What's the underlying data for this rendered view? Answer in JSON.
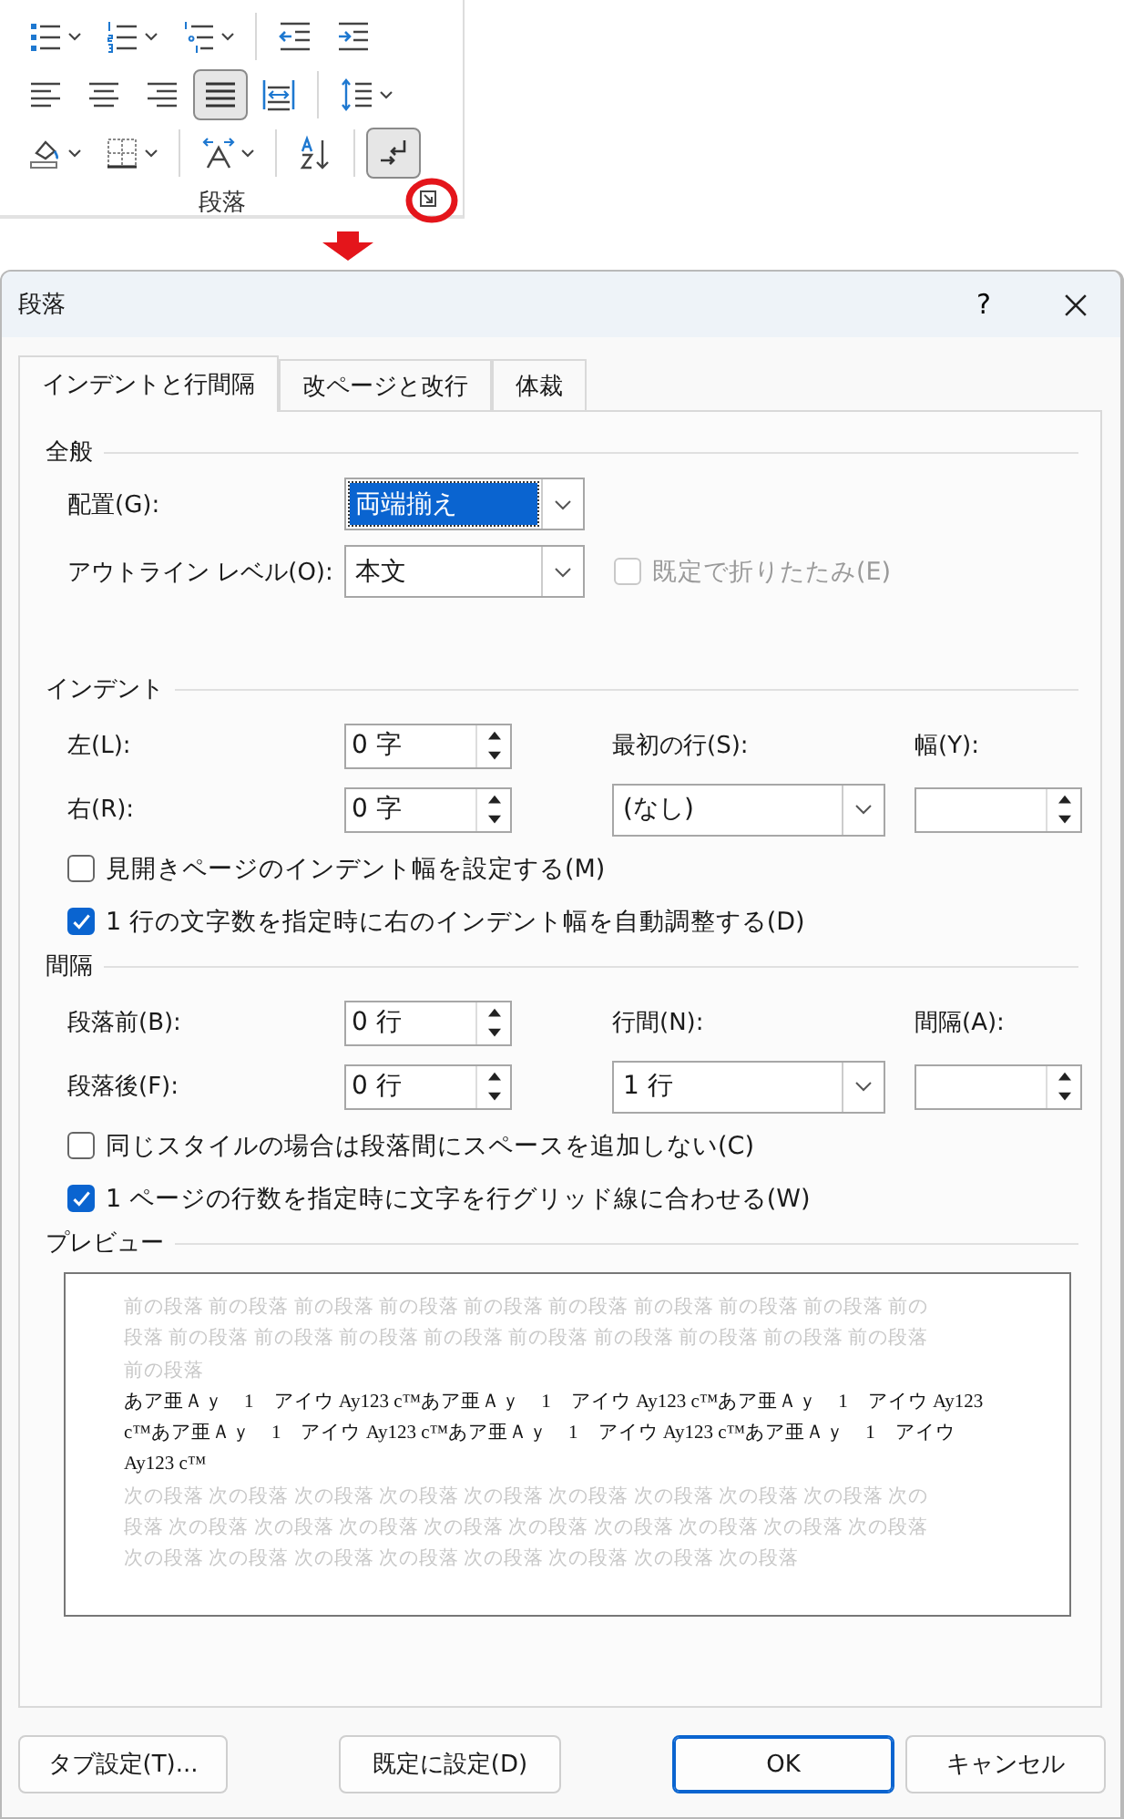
{
  "ribbon": {
    "rows": [
      [
        [
          {
            "kind": "bullets",
            "dropdown": true,
            "selected": false
          },
          {
            "kind": "numbering",
            "dropdown": true,
            "selected": false
          },
          {
            "kind": "multilevel",
            "dropdown": true,
            "selected": false
          }
        ],
        [
          {
            "kind": "decrease-indent",
            "dropdown": false,
            "selected": false
          },
          {
            "kind": "increase-indent",
            "dropdown": false,
            "selected": false
          }
        ]
      ],
      [
        [
          {
            "kind": "align-left",
            "dropdown": false,
            "selected": false
          },
          {
            "kind": "center",
            "dropdown": false,
            "selected": false
          },
          {
            "kind": "align-right",
            "dropdown": false,
            "selected": false
          },
          {
            "kind": "justify",
            "dropdown": false,
            "selected": true
          },
          {
            "kind": "distributed",
            "dropdown": false,
            "selected": false
          }
        ],
        [
          {
            "kind": "line-spacing",
            "dropdown": true,
            "selected": false
          }
        ]
      ],
      [
        [
          {
            "kind": "shading",
            "dropdown": true,
            "selected": false
          },
          {
            "kind": "borders",
            "dropdown": true,
            "selected": false
          }
        ],
        [
          {
            "kind": "asian-layout",
            "dropdown": true,
            "selected": false
          }
        ],
        [
          {
            "kind": "sort",
            "dropdown": false,
            "selected": false
          }
        ],
        [
          {
            "kind": "text-direction",
            "dropdown": false,
            "selected": true
          }
        ]
      ]
    ],
    "group_label": "段落"
  },
  "dialog": {
    "title": "段落",
    "help": "?"
  },
  "tabs": [
    {
      "label": "インデントと行間隔",
      "selected": true
    },
    {
      "label": "改ページと改行",
      "selected": false
    },
    {
      "label": "体裁",
      "selected": false
    }
  ],
  "general": {
    "heading": "全般",
    "alignment": {
      "label": "配置(G):",
      "value": "両端揃え",
      "focused": true
    },
    "outline": {
      "label": "アウトライン レベル(O):",
      "value": "本文",
      "focused": false
    },
    "collapse": {
      "label": "既定で折りたたみ(E)",
      "checked": false,
      "disabled": true
    }
  },
  "indent": {
    "heading": "インデント",
    "left": {
      "label": "左(L):",
      "value": "0 字"
    },
    "right": {
      "label": "右(R):",
      "value": "0 字"
    },
    "first_line": {
      "label": "最初の行(S):",
      "value": "(なし)"
    },
    "by": {
      "label": "幅(Y):"
    },
    "checks": [
      {
        "label": "見開きページのインデント幅を設定する(M)",
        "checked": false
      },
      {
        "label": "1 行の文字数を指定時に右のインデント幅を自動調整する(D)",
        "checked": true
      }
    ]
  },
  "spacing": {
    "heading": "間隔",
    "before": {
      "label": "段落前(B):",
      "value": "0 行"
    },
    "after": {
      "label": "段落後(F):",
      "value": "0 行"
    },
    "line_spacing": {
      "label": "行間(N):",
      "value": "1 行"
    },
    "at": {
      "label": "間隔(A):"
    },
    "checks": [
      {
        "label": "同じスタイルの場合は段落間にスペースを追加しない(C)",
        "checked": false
      },
      {
        "label": "1 ページの行数を指定時に文字を行グリッド線に合わせる(W)",
        "checked": true
      }
    ]
  },
  "preview": {
    "heading": "プレビュー",
    "lines": [
      {
        "kind": "previous",
        "text": "前の段落 前の段落 前の段落 前の段落 前の段落 前の段落 前の段落 前の段落 前の段落 前の"
      },
      {
        "kind": "previous",
        "text": "段落 前の段落 前の段落 前の段落 前の段落 前の段落 前の段落 前の段落 前の段落 前の段落"
      },
      {
        "kind": "previous",
        "text": "前の段落"
      },
      {
        "kind": "current",
        "text": "あア亜Ａｙ　1　アイウ Ay123 c™あア亜Ａｙ　1　アイウ Ay123 c™あア亜Ａｙ　1　アイウ Ay123"
      },
      {
        "kind": "current",
        "text": "c™あア亜Ａｙ　1　アイウ Ay123 c™あア亜Ａｙ　1　アイウ Ay123 c™あア亜Ａｙ　1　アイウ"
      },
      {
        "kind": "current",
        "text": "Ay123 c™"
      },
      {
        "kind": "next",
        "text": "次の段落 次の段落 次の段落 次の段落 次の段落 次の段落 次の段落 次の段落 次の段落 次の"
      },
      {
        "kind": "next",
        "text": "段落 次の段落 次の段落 次の段落 次の段落 次の段落 次の段落 次の段落 次の段落 次の段落"
      },
      {
        "kind": "next",
        "text": "次の段落 次の段落 次の段落 次の段落 次の段落 次の段落 次の段落 次の段落"
      }
    ]
  },
  "buttons": [
    {
      "label": "タブ設定(T)...",
      "default": false
    },
    {
      "label": "既定に設定(D)",
      "default": false
    },
    {
      "label": "OK",
      "default": true
    },
    {
      "label": "キャンセル",
      "default": false
    }
  ]
}
